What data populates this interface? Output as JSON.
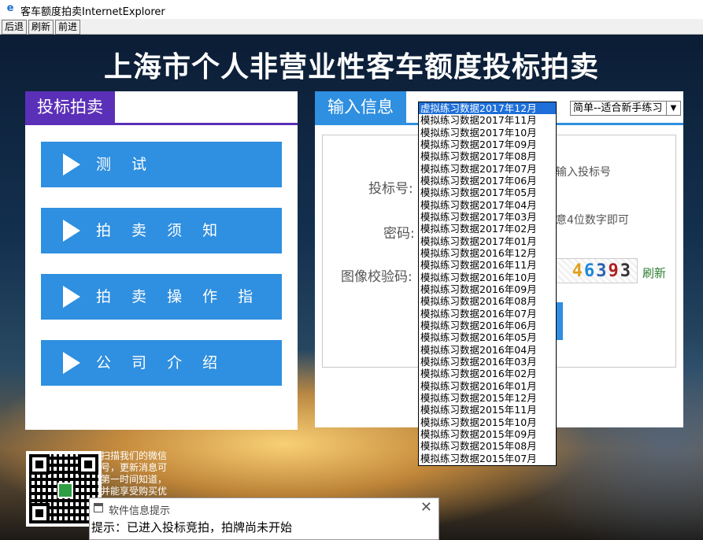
{
  "window": {
    "title": "客车额度拍卖InternetExplorer"
  },
  "nav": {
    "back": "后退",
    "refresh": "刷新",
    "forward": "前进"
  },
  "main_title": "上海市个人非营业性客车额度投标拍卖",
  "left_panel": {
    "tab": "投标拍卖",
    "buttons": [
      {
        "label": "测 试"
      },
      {
        "label": "拍 卖 须 知"
      },
      {
        "label": "拍 卖 操 作 指 南"
      },
      {
        "label": "公 司 介 绍"
      }
    ]
  },
  "right_panel": {
    "tab": "输入信息",
    "bid_label": "投标号:",
    "bid_hint": "输入投标号",
    "password_label": "密码:",
    "password_hint": "意4位数字即可",
    "captcha_label": "图像校验码:",
    "captcha_digits": [
      "4",
      "6",
      "3",
      "9",
      "3"
    ],
    "refresh": "刷新"
  },
  "mode_select": {
    "selected": "简单--适合新手练习"
  },
  "dropdown": {
    "items": [
      "虚拟练习数据2017年12月",
      "模拟练习数据2017年11月",
      "模拟练习数据2017年10月",
      "模拟练习数据2017年09月",
      "模拟练习数据2017年08月",
      "模拟练习数据2017年07月",
      "模拟练习数据2017年06月",
      "模拟练习数据2017年05月",
      "模拟练习数据2017年04月",
      "模拟练习数据2017年03月",
      "模拟练习数据2017年02月",
      "模拟练习数据2017年01月",
      "模拟练习数据2016年12月",
      "模拟练习数据2016年11月",
      "模拟练习数据2016年10月",
      "模拟练习数据2016年09月",
      "模拟练习数据2016年08月",
      "模拟练习数据2016年07月",
      "模拟练习数据2016年06月",
      "模拟练习数据2016年05月",
      "模拟练习数据2016年04月",
      "模拟练习数据2016年03月",
      "模拟练习数据2016年02月",
      "模拟练习数据2016年01月",
      "模拟练习数据2015年12月",
      "模拟练习数据2015年11月",
      "模拟练习数据2015年10月",
      "模拟练习数据2015年09月",
      "模拟练习数据2015年08月",
      "模拟练习数据2015年07月"
    ]
  },
  "wechat": {
    "text": "扫描我们的微信号，更新消息可第一时间知道，并能享受购买优惠"
  },
  "popup": {
    "title": "软件信息提示",
    "close": "✕",
    "message": "提示：已进入投标竞拍，拍牌尚未开始"
  },
  "colors": {
    "purple_tab": "#5b30b8",
    "blue_accent": "#2f8fe0",
    "selection": "#1e6fd9"
  }
}
